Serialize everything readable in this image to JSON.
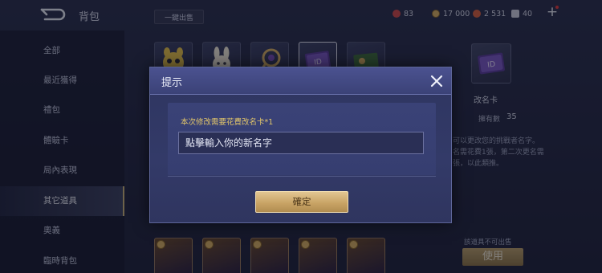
{
  "header": {
    "title": "背包",
    "sell_all": "一鍵出售",
    "currencies": [
      {
        "name": "gems",
        "value": "83",
        "color": "#d24a4a"
      },
      {
        "name": "gold",
        "value": "17 000",
        "color": "#d8b063"
      },
      {
        "name": "vouchers",
        "value": "2 531",
        "color": "#d8603f"
      },
      {
        "name": "tickets",
        "value": "40",
        "color": "#cfd2de"
      }
    ],
    "add_icon": "plus-icon"
  },
  "sidebar": {
    "items": [
      {
        "label": "全部"
      },
      {
        "label": "最近獲得"
      },
      {
        "label": "禮包"
      },
      {
        "label": "體驗卡"
      },
      {
        "label": "局內表現"
      },
      {
        "label": "其它道具",
        "active": true
      },
      {
        "label": "奧義"
      },
      {
        "label": "臨時背包"
      }
    ]
  },
  "detail": {
    "name": "改名卡",
    "owned_label": "擁有數",
    "owned_count": "35",
    "description_lines": [
      "可以更改您的挑戰者名字。",
      "名需花費1張，第二次更名需",
      "張，以此類推。"
    ],
    "unsellable": "該道具不可出售",
    "use_label": "使用"
  },
  "modal": {
    "title": "提示",
    "message": "本次修改需要花費改名卡*1",
    "input_placeholder": "點擊輸入你的新名字",
    "confirm_label": "確定",
    "close_icon": "close-icon"
  },
  "colors": {
    "accent_gold": "#c9a466",
    "message_text": "#e1c56a",
    "modal_bg": "#333a68"
  }
}
